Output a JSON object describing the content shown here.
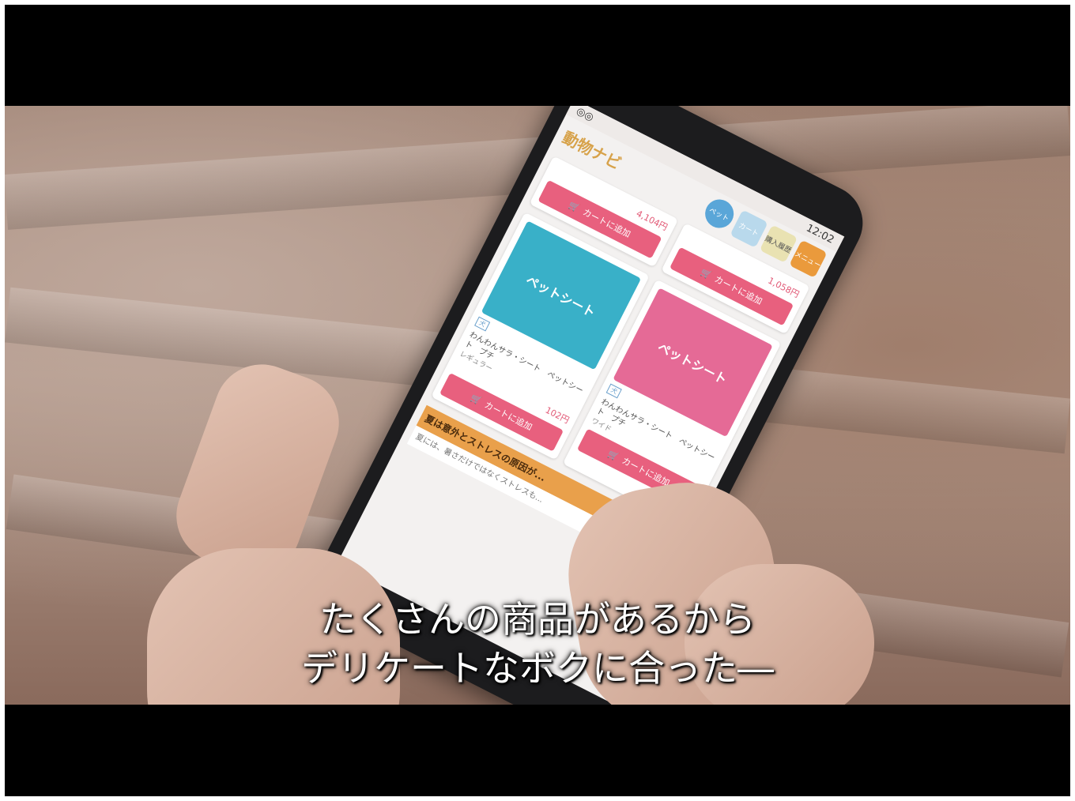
{
  "app": {
    "logo": "動物ナビ",
    "status_time": "12:02",
    "nav": [
      {
        "label": "ペット",
        "color": "#5aa6d8"
      },
      {
        "label": "カート",
        "color": "#b9d9ec"
      },
      {
        "label": "購入履歴",
        "color": "#e9e2b2"
      },
      {
        "label": "メニュー",
        "color": "#ea9a3c"
      }
    ]
  },
  "products_top": [
    {
      "price": "4,104円",
      "cart_label": "カートに追加"
    },
    {
      "price": "1,058円",
      "cart_label": "カートに追加"
    }
  ],
  "products": [
    {
      "image_label": "ペットシート",
      "image_color": "#39b0c8",
      "tag": "犬",
      "name": "わんわんサラ・シート　ペットシート　プチ",
      "detail": "レギュラー",
      "price": "102円",
      "cart_label": "カートに追加"
    },
    {
      "image_label": "ペットシート",
      "image_color": "#e56a96",
      "tag": "犬",
      "name": "わんわんサラ・シート　ペットシート　プチ",
      "detail": "ワイド",
      "price": "",
      "cart_label": "カートに追加"
    }
  ],
  "banner": {
    "title": "夏は意外とストレスの原因が...",
    "text": "夏には、暑さだけではなくストレスも..."
  },
  "subtitles": {
    "line1": "たくさんの商品があるから",
    "line2": "デリケートなボクに合った―"
  },
  "colors": {
    "accent_pink": "#e8607e",
    "accent_orange": "#ea9a3c"
  }
}
